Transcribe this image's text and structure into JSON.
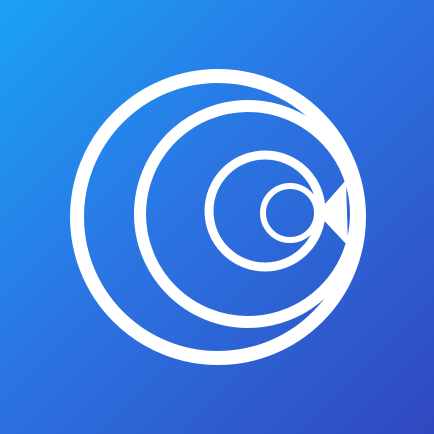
{
  "app_icon": {
    "icon": "concentric-rings-logo-icon",
    "colors": {
      "gradient_start": "#1aa2f6",
      "gradient_mid": "#2b74e2",
      "gradient_end": "#3048bf",
      "rings": "#ffffff"
    },
    "ring_count": 4
  }
}
